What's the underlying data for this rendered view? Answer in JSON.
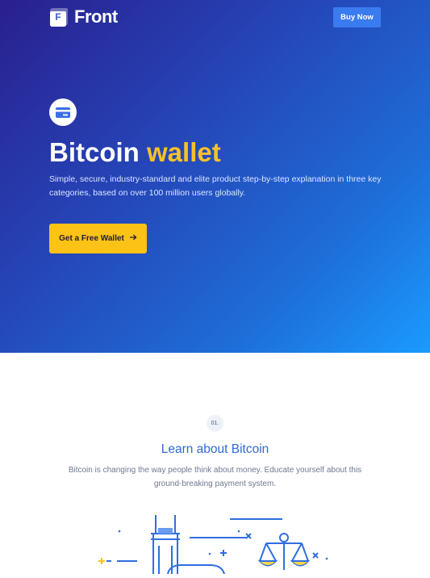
{
  "header": {
    "logo_letter": "F",
    "brand": "Front",
    "buy_label": "Buy Now"
  },
  "hero": {
    "icon": "credit-card-icon",
    "title_main": "Bitcoin",
    "title_accent": "wallet",
    "description": "Simple, secure, industry-standard and elite product step-by-step explanation in three key categories, based on over 100 million users globally.",
    "cta_label": "Get a Free Wallet",
    "cta_icon": "arrow-right-icon"
  },
  "section": {
    "step": "01.",
    "title": "Learn about Bitcoin",
    "description": "Bitcoin is changing the way people think about money. Educate yourself about this ground-breaking payment system."
  },
  "colors": {
    "hero_start": "#2a1f8f",
    "hero_end": "#1a9bff",
    "accent_yellow": "#fcc215",
    "primary_blue": "#3169d8"
  }
}
